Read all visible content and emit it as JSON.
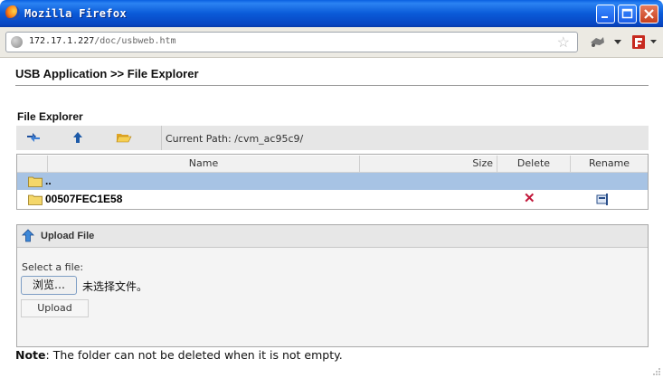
{
  "window": {
    "title": "Mozilla Firefox"
  },
  "browser": {
    "url_host": "172.17.1.227",
    "url_path": "/doc/usbweb.htm"
  },
  "page": {
    "heading": "USB Application >> File Explorer",
    "section_title": "File Explorer",
    "current_path_label": "Current Path:",
    "current_path": "/cvm_ac95c9/",
    "columns": [
      "Name",
      "Size",
      "Delete",
      "Rename"
    ],
    "rows": [
      {
        "name": "..",
        "selected": true
      },
      {
        "name": "00507FEC1E58",
        "selected": false
      }
    ],
    "upload": {
      "title": "Upload File",
      "select_label": "Select a file:",
      "browse_label": "浏览…",
      "no_file_label": "未选择文件。",
      "upload_button": "Upload"
    },
    "note_label": "Note",
    "note_text": ": The folder can not be deleted when it is not empty."
  },
  "colors": {
    "titlebar": "#0a5ad8",
    "selected_row": "#a7c3e4",
    "delete": "#c2183a"
  }
}
